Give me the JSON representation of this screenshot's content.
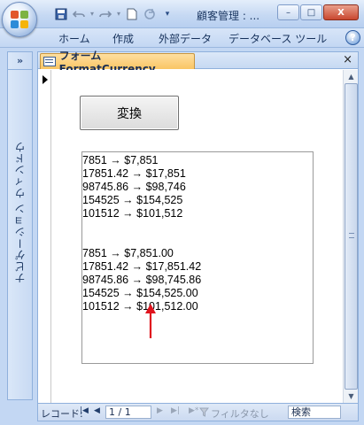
{
  "window": {
    "title": "顧客管理 : ...",
    "qat_icons": [
      "save-icon",
      "undo-icon",
      "redo-icon",
      "new-icon",
      "refresh-icon",
      "customize-icon"
    ],
    "controls": {
      "minimize": "–",
      "maximize": "□",
      "close": "X"
    }
  },
  "ribbon": {
    "tabs": [
      "ホーム",
      "作成",
      "外部データ",
      "データベース ツール"
    ],
    "help": "?"
  },
  "nav_pane": {
    "expand": "»",
    "label": "ナビゲーション ウィンドウ"
  },
  "doc": {
    "tab_label": "フォームFormatCurrency",
    "close": "×"
  },
  "form": {
    "convert_button": "変換",
    "output_lines": [
      "7851 → $7,851",
      "17851.42 → $17,851",
      "98745.86 → $98,746",
      "154525 → $154,525",
      "101512 → $101,512",
      "",
      "",
      "7851 → $7,851.00",
      "17851.42 → $17,851.42",
      "98745.86 → $98,745.86",
      "154525 → $154,525.00",
      "101512 → $101,512.00"
    ],
    "arrow_color": "#e0141e"
  },
  "statusbar": {
    "record_label": "レコード:",
    "first": "|◀",
    "prev": "◀",
    "record_value": "1 / 1",
    "next": "▶",
    "last": "▶|",
    "new": "▶*",
    "filter": "フィルタなし",
    "search": "検索"
  }
}
